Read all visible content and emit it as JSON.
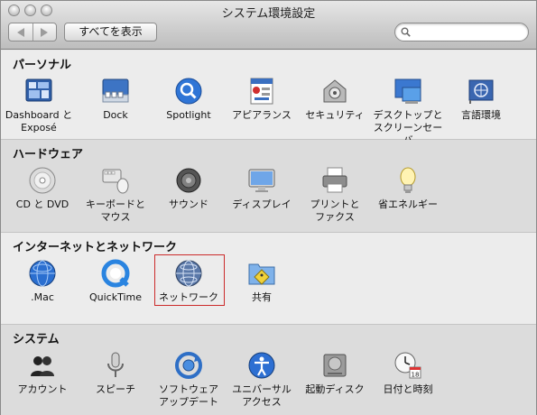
{
  "window": {
    "title": "システム環境設定"
  },
  "toolbar": {
    "show_all": "すべてを表示",
    "search_placeholder": ""
  },
  "sections": [
    {
      "title": "パーソナル",
      "items": [
        {
          "label": "Dashboard と\nExposé",
          "icon": "dashboard-icon"
        },
        {
          "label": "Dock",
          "icon": "dock-icon"
        },
        {
          "label": "Spotlight",
          "icon": "spotlight-icon"
        },
        {
          "label": "アピアランス",
          "icon": "appearance-icon"
        },
        {
          "label": "セキュリティ",
          "icon": "security-icon"
        },
        {
          "label": "デスクトップと\nスクリーンセーバ",
          "icon": "desktop-icon"
        },
        {
          "label": "言語環境",
          "icon": "language-icon"
        }
      ]
    },
    {
      "title": "ハードウェア",
      "items": [
        {
          "label": "CD と DVD",
          "icon": "cd-dvd-icon"
        },
        {
          "label": "キーボードと\nマウス",
          "icon": "keyboard-mouse-icon"
        },
        {
          "label": "サウンド",
          "icon": "sound-icon"
        },
        {
          "label": "ディスプレイ",
          "icon": "display-icon"
        },
        {
          "label": "プリントと\nファクス",
          "icon": "printer-icon"
        },
        {
          "label": "省エネルギー",
          "icon": "energy-saver-icon"
        }
      ]
    },
    {
      "title": "インターネットとネットワーク",
      "items": [
        {
          "label": ".Mac",
          "icon": "dotmac-icon"
        },
        {
          "label": "QuickTime",
          "icon": "quicktime-icon"
        },
        {
          "label": "ネットワーク",
          "icon": "network-icon",
          "selected": true
        },
        {
          "label": "共有",
          "icon": "sharing-icon"
        }
      ]
    },
    {
      "title": "システム",
      "items": [
        {
          "label": "アカウント",
          "icon": "accounts-icon"
        },
        {
          "label": "スピーチ",
          "icon": "speech-icon"
        },
        {
          "label": "ソフトウェア\nアップデート",
          "icon": "software-update-icon"
        },
        {
          "label": "ユニバーサル\nアクセス",
          "icon": "universal-access-icon"
        },
        {
          "label": "起動ディスク",
          "icon": "startup-disk-icon"
        },
        {
          "label": "日付と時刻",
          "icon": "date-time-icon"
        }
      ]
    }
  ]
}
